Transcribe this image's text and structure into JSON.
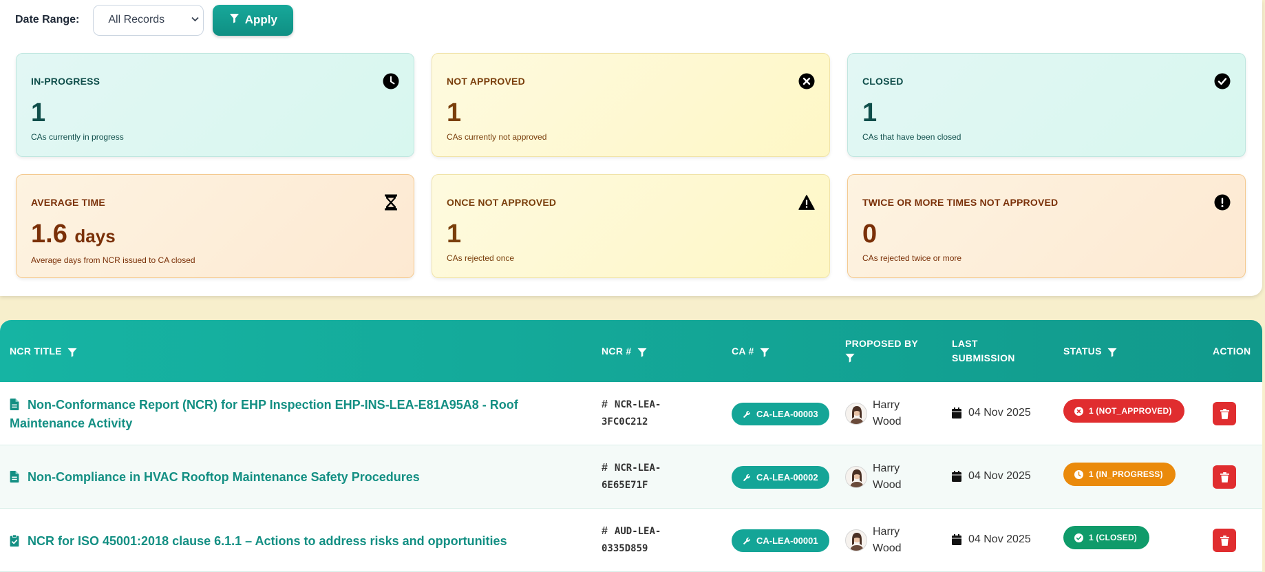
{
  "filter": {
    "label": "Date Range:",
    "selected": "All Records",
    "apply_label": "Apply"
  },
  "cards": [
    {
      "title": "IN-PROGRESS",
      "value": "1",
      "unit": "",
      "subtitle": "CAs currently in progress",
      "icon": "clock-icon",
      "theme": "teal"
    },
    {
      "title": "NOT APPROVED",
      "value": "1",
      "unit": "",
      "subtitle": "CAs currently not approved",
      "icon": "x-circle-icon",
      "theme": "yellow"
    },
    {
      "title": "CLOSED",
      "value": "1",
      "unit": "",
      "subtitle": "CAs that have been closed",
      "icon": "check-circle-icon",
      "theme": "teal"
    },
    {
      "title": "AVERAGE TIME",
      "value": "1.6",
      "unit": "days",
      "subtitle": "Average days from NCR issued to CA closed",
      "icon": "hourglass-icon",
      "theme": "orange"
    },
    {
      "title": "ONCE NOT APPROVED",
      "value": "1",
      "unit": "",
      "subtitle": "CAs rejected once",
      "icon": "warning-icon",
      "theme": "yellow"
    },
    {
      "title": "TWICE OR MORE TIMES NOT APPROVED",
      "value": "0",
      "unit": "",
      "subtitle": "CAs rejected twice or more",
      "icon": "exclamation-circle-icon",
      "theme": "orange"
    }
  ],
  "table": {
    "headers": {
      "title": "NCR TITLE",
      "ncr": "NCR #",
      "ca": "CA #",
      "proposed_line1": "PROPOSED BY",
      "last_line1": "LAST",
      "last_line2": "SUBMISSION",
      "status": "STATUS",
      "action": "ACTION"
    },
    "rows": [
      {
        "title": "Non-Conformance Report (NCR) for EHP Inspection EHP-INS-LEA-E81A95A8 - Roof Maintenance Activity",
        "title_icon": "file-icon",
        "ncr_line1": "NCR-LEA-",
        "ncr_line2": "3FC0C212",
        "ca": "CA-LEA-00003",
        "person_first": "Harry",
        "person_last": "Wood",
        "date": "04 Nov 2025",
        "status": "1 (NOT_APPROVED)",
        "status_color": "#e02d2f"
      },
      {
        "title": "Non-Compliance in HVAC Rooftop Maintenance Safety Procedures",
        "title_icon": "file-icon",
        "ncr_line1": "NCR-LEA-",
        "ncr_line2": "6E65E71F",
        "ca": "CA-LEA-00002",
        "person_first": "Harry",
        "person_last": "Wood",
        "date": "04 Nov 2025",
        "status": "1 (IN_PROGRESS)",
        "status_color": "#ea8a0c"
      },
      {
        "title": "NCR for ISO 45001:2018 clause 6.1.1 – Actions to address risks and opportunities",
        "title_icon": "clipboard-check-icon",
        "ncr_line1": "AUD-LEA-",
        "ncr_line2": "0335D859",
        "ca": "CA-LEA-00001",
        "person_first": "Harry",
        "person_last": "Wood",
        "date": "04 Nov 2025",
        "status": "1 (CLOSED)",
        "status_color": "#0f9b6a"
      }
    ]
  }
}
